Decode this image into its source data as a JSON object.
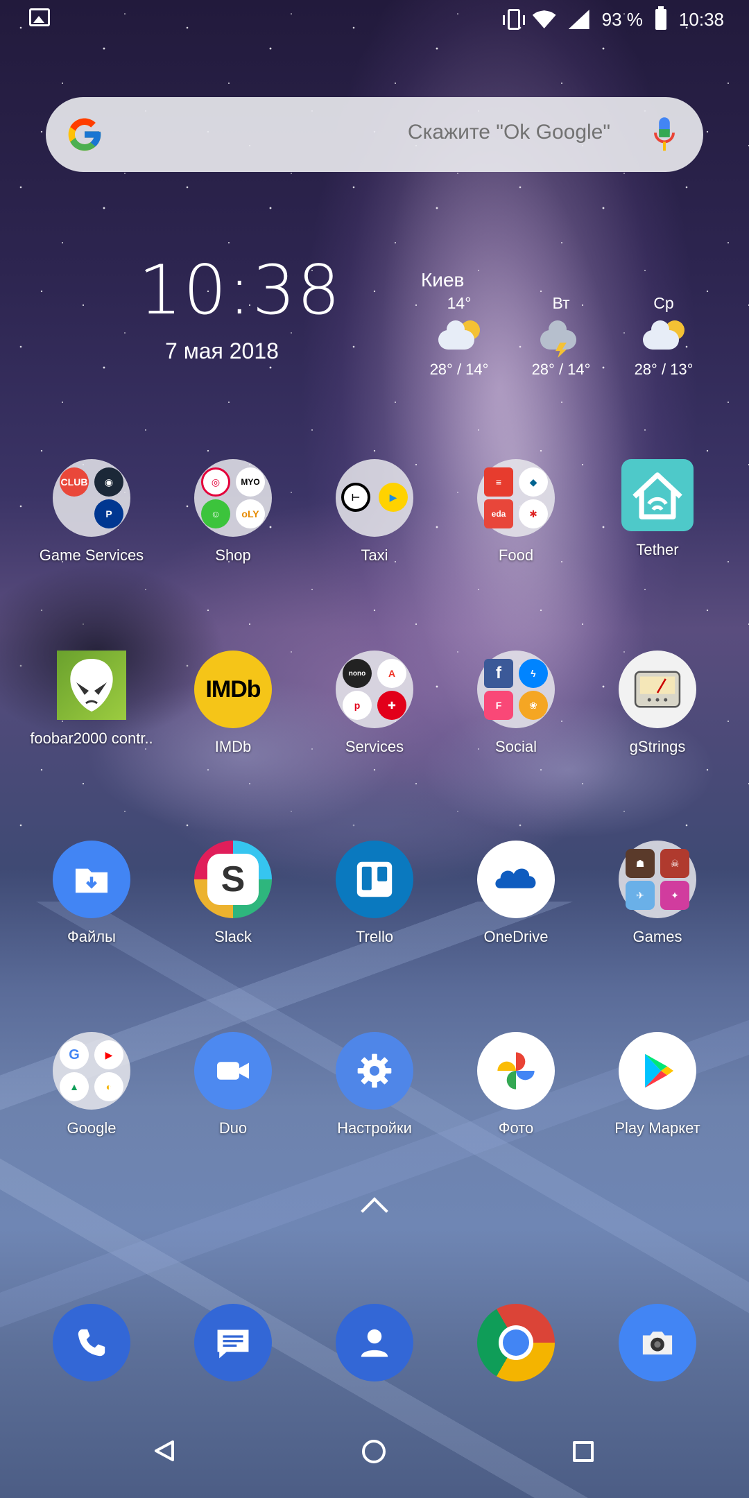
{
  "status_bar": {
    "battery": "93 %",
    "time": "10:38"
  },
  "search": {
    "hint": "Скажите \"Ok Google\""
  },
  "clock_widget": {
    "time": "10:38",
    "date": "7 мая 2018"
  },
  "weather": {
    "city": "Киев",
    "days": [
      {
        "label": "14°",
        "temps": "28° / 14°",
        "icon": "partly-cloudy-icon"
      },
      {
        "label": "Вт",
        "temps": "28° / 14°",
        "icon": "thunderstorm-icon"
      },
      {
        "label": "Ср",
        "temps": "28° / 13°",
        "icon": "partly-cloudy-icon"
      }
    ]
  },
  "apps": {
    "row1": [
      "Game Services",
      "Shop",
      "Taxi",
      "Food",
      "Tether"
    ],
    "row2": [
      "foobar2000 contr..",
      "IMDb",
      "Services",
      "Social",
      "gStrings"
    ],
    "row3": [
      "Файлы",
      "Slack",
      "Trello",
      "OneDrive",
      "Games"
    ],
    "row4": [
      "Google",
      "Duo",
      "Настройки",
      "Фото",
      "Play Маркет"
    ]
  },
  "icon_text": {
    "imdb": "IMDb",
    "nono": "nono",
    "s": "S",
    "myo_m": "M",
    "myo_y": "Y",
    "myo_o": "O",
    "oly": "oLY",
    "eda": "eda",
    "club": "CLUB"
  },
  "colors": {
    "duo": "#4d89f0",
    "settings": "#4f86e8",
    "trello": "#0a79bf",
    "phone": "#3367d6"
  }
}
